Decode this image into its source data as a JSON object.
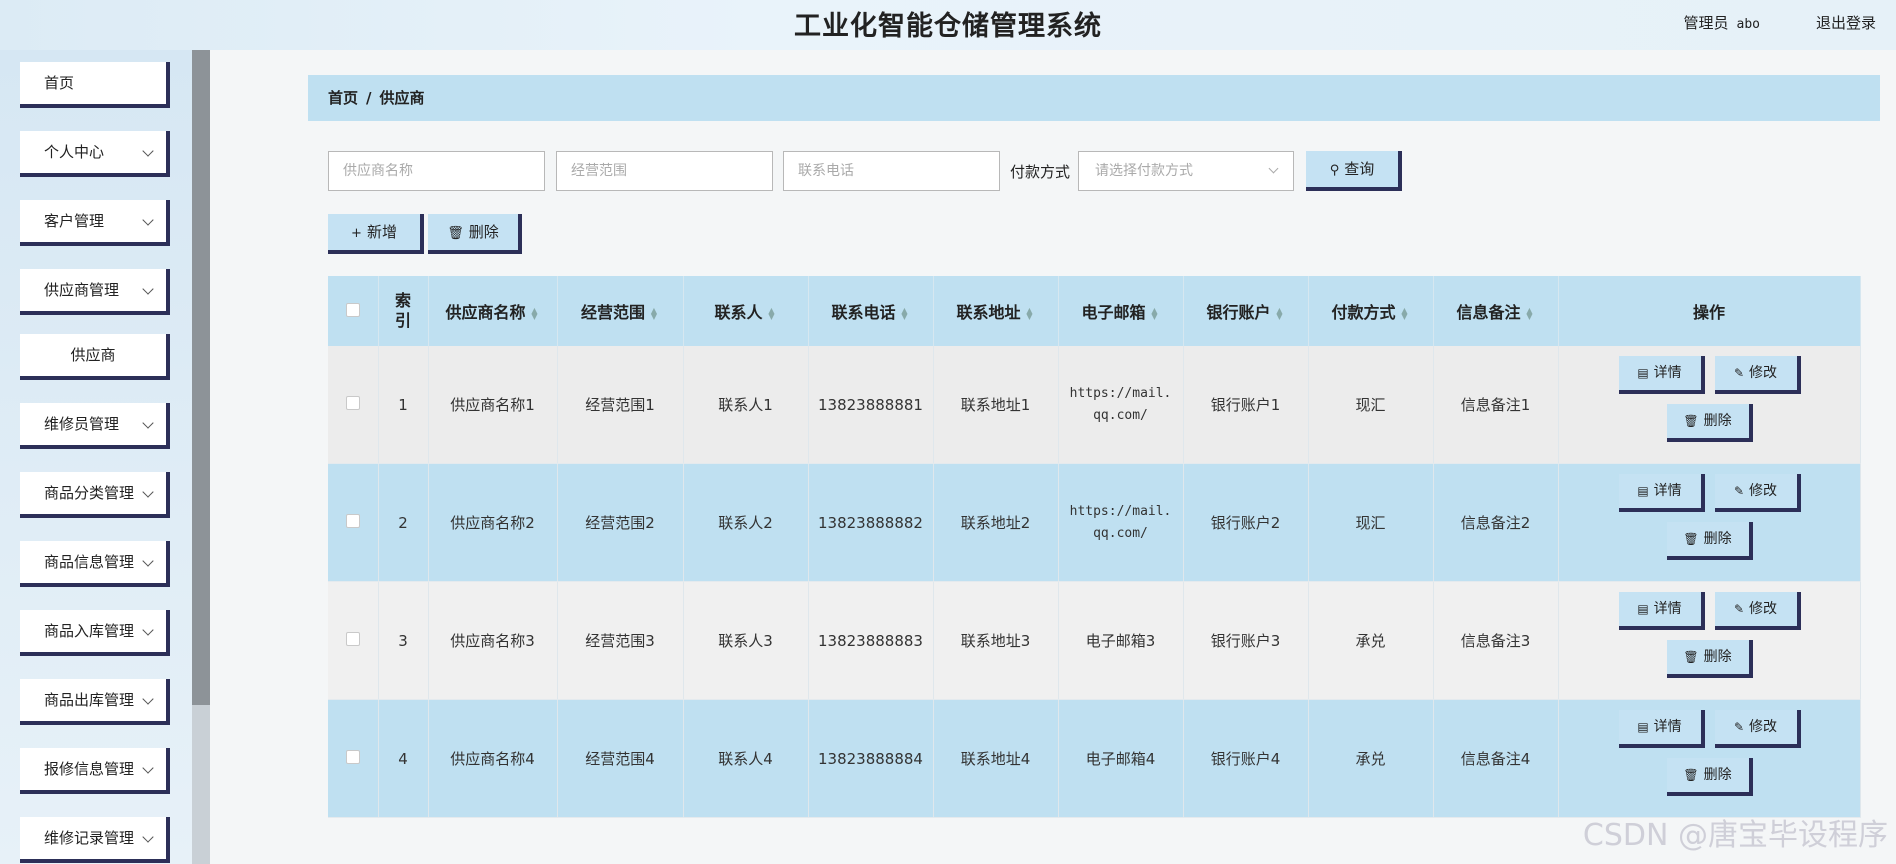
{
  "header": {
    "title": "工业化智能仓储管理系统",
    "admin_label": "管理员",
    "username": "abo",
    "logout": "退出登录"
  },
  "sidebar": {
    "items": [
      {
        "label": "首页",
        "has_arrow": false
      },
      {
        "label": "个人中心",
        "has_arrow": true
      },
      {
        "label": "客户管理",
        "has_arrow": true
      },
      {
        "label": "供应商管理",
        "has_arrow": true
      },
      {
        "label": "供应商",
        "has_arrow": false,
        "sub": true
      },
      {
        "label": "维修员管理",
        "has_arrow": true
      },
      {
        "label": "商品分类管理",
        "has_arrow": true
      },
      {
        "label": "商品信息管理",
        "has_arrow": true
      },
      {
        "label": "商品入库管理",
        "has_arrow": true
      },
      {
        "label": "商品出库管理",
        "has_arrow": true
      },
      {
        "label": "报修信息管理",
        "has_arrow": true
      },
      {
        "label": "维修记录管理",
        "has_arrow": true
      }
    ]
  },
  "breadcrumb": {
    "home": "首页",
    "separator": "/",
    "current": "供应商"
  },
  "search": {
    "name_placeholder": "供应商名称",
    "scope_placeholder": "经营范围",
    "phone_placeholder": "联系电话",
    "pay_label": "付款方式",
    "pay_placeholder": "请选择付款方式",
    "query_button": "查询"
  },
  "actions": {
    "add": "新增",
    "delete": "删除"
  },
  "table": {
    "headers": {
      "index": "索引",
      "name": "供应商名称",
      "scope": "经营范围",
      "contact": "联系人",
      "phone": "联系电话",
      "address": "联系地址",
      "email": "电子邮箱",
      "bank": "银行账户",
      "pay": "付款方式",
      "note": "信息备注",
      "ops": "操作"
    },
    "op_labels": {
      "detail": "详情",
      "edit": "修改",
      "delete": "删除"
    },
    "rows": [
      {
        "index": "1",
        "name": "供应商名称1",
        "scope": "经营范围1",
        "contact": "联系人1",
        "phone": "13823888881",
        "address": "联系地址1",
        "email": "https://mail.\nqq.com/",
        "bank": "银行账户1",
        "pay": "现汇",
        "note": "信息备注1"
      },
      {
        "index": "2",
        "name": "供应商名称2",
        "scope": "经营范围2",
        "contact": "联系人2",
        "phone": "13823888882",
        "address": "联系地址2",
        "email": "https://mail.\nqq.com/",
        "bank": "银行账户2",
        "pay": "现汇",
        "note": "信息备注2"
      },
      {
        "index": "3",
        "name": "供应商名称3",
        "scope": "经营范围3",
        "contact": "联系人3",
        "phone": "13823888883",
        "address": "联系地址3",
        "email": "电子邮箱3",
        "bank": "银行账户3",
        "pay": "承兑",
        "note": "信息备注3"
      },
      {
        "index": "4",
        "name": "供应商名称4",
        "scope": "经营范围4",
        "contact": "联系人4",
        "phone": "13823888884",
        "address": "联系地址4",
        "email": "电子邮箱4",
        "bank": "银行账户4",
        "pay": "承兑",
        "note": "信息备注4"
      }
    ]
  },
  "watermark": "CSDN @唐宝毕设程序"
}
